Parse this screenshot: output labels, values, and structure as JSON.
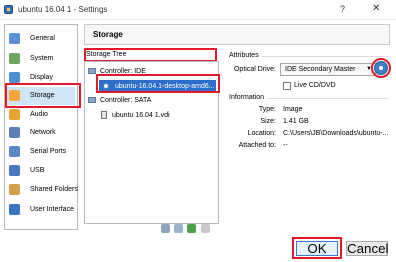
{
  "window": {
    "title": "ubuntu 16.04 1 - Settings",
    "help_label": "?",
    "close_label": "✕"
  },
  "sidebar": {
    "items": [
      {
        "label": "General",
        "icon": "general-icon",
        "color": "#5b8fd6"
      },
      {
        "label": "System",
        "icon": "system-icon",
        "color": "#6fa65f"
      },
      {
        "label": "Display",
        "icon": "display-icon",
        "color": "#4d8ed1"
      },
      {
        "label": "Storage",
        "icon": "storage-icon",
        "color": "#f6a73b",
        "active": true
      },
      {
        "label": "Audio",
        "icon": "audio-icon",
        "color": "#e6a531"
      },
      {
        "label": "Network",
        "icon": "network-icon",
        "color": "#5a7fb9"
      },
      {
        "label": "Serial Ports",
        "icon": "serial-ports-icon",
        "color": "#5b88c7"
      },
      {
        "label": "USB",
        "icon": "usb-icon",
        "color": "#4b79c1"
      },
      {
        "label": "Shared Folders",
        "icon": "shared-folders-icon",
        "color": "#d2a24a"
      },
      {
        "label": "User Interface",
        "icon": "user-interface-icon",
        "color": "#3b76c2"
      }
    ]
  },
  "main": {
    "title": "Storage"
  },
  "storage_tree": {
    "label": "Storage Tree",
    "controllers": [
      {
        "label": "Controller: IDE",
        "items": [
          "ubuntu-16.04.1-desktop-amd6..."
        ]
      },
      {
        "label": "Controller: SATA",
        "items": [
          "ubuntu 16.04 1.vdi"
        ]
      }
    ]
  },
  "attributes": {
    "label": "Attributes",
    "optical_drive_label": "Optical Drive:",
    "optical_drive_value": "IDE Secondary Master",
    "live_cd_label": "Live CD/DVD"
  },
  "information": {
    "label": "Information",
    "rows": [
      {
        "label": "Type:",
        "value": "Image"
      },
      {
        "label": "Size:",
        "value": "1.41 GB"
      },
      {
        "label": "Location:",
        "value": "C:\\Users\\JB\\Downloads\\ubuntu-..."
      },
      {
        "label": "Attached to:",
        "value": "--"
      }
    ]
  },
  "buttons": {
    "ok": "OK",
    "cancel": "Cancel"
  },
  "colors": {
    "highlight": "#e11a2b",
    "selection": "#2c6ec9"
  }
}
